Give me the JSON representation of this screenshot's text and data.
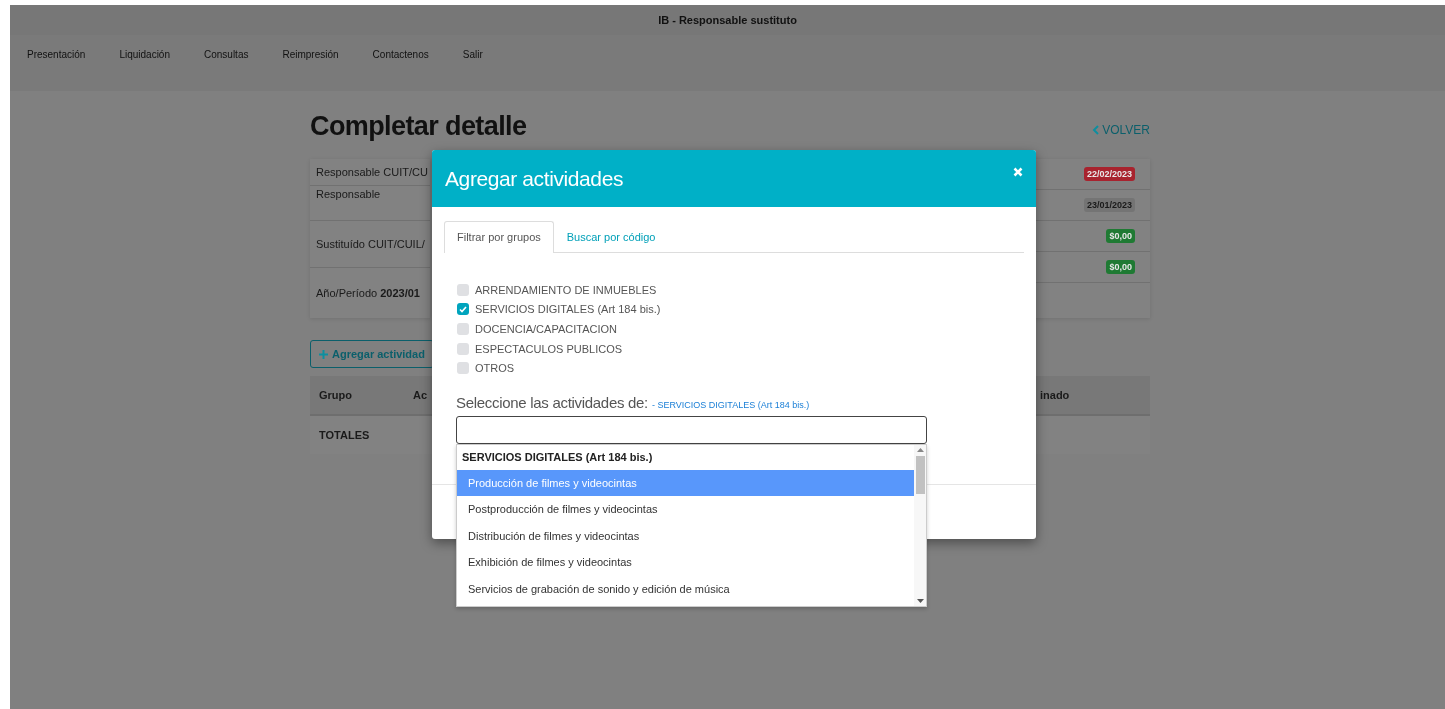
{
  "header": {
    "title": "IB - Responsable sustituto"
  },
  "menu": [
    {
      "label": "Presentación"
    },
    {
      "label": "Liquidación"
    },
    {
      "label": "Consultas"
    },
    {
      "label": "Reimpresión"
    },
    {
      "label": "Contactenos"
    },
    {
      "label": "Salir"
    }
  ],
  "page": {
    "title": "Completar detalle",
    "back_link": "VOLVER"
  },
  "summary_left": [
    {
      "label": "Responsable CUIT/CU"
    },
    {
      "label": "Responsable"
    },
    {
      "label": "Sustituído CUIT/CUIL/"
    },
    {
      "label": "Año/Período **2023/01**"
    }
  ],
  "summary_right": [
    {
      "badge": "22/02/2023",
      "color": "#a8232e"
    },
    {
      "badge": "23/01/2023",
      "color": "#747474"
    },
    {
      "badge": "$0,00",
      "color": "#1f7a33"
    },
    {
      "badge": "$0,00",
      "color": "#1f7a33"
    }
  ],
  "add_button": {
    "label": "Agregar actividad"
  },
  "table": {
    "columns": [
      "Grupo",
      "Ac",
      "inado"
    ],
    "totals_label": "TOTALES"
  },
  "modal": {
    "title": "Agregar actividades",
    "tabs": [
      {
        "label": "Filtrar por grupos",
        "selected": true
      },
      {
        "label": "Buscar por código",
        "selected": false
      }
    ],
    "groups": [
      {
        "label": "ARRENDAMIENTO DE INMUEBLES",
        "checked": false
      },
      {
        "label": "SERVICIOS DIGITALES (Art 184 bis.)",
        "checked": true
      },
      {
        "label": "DOCENCIA/CAPACITACION",
        "checked": false
      },
      {
        "label": "ESPECTACULOS PUBLICOS",
        "checked": false
      },
      {
        "label": "OTROS",
        "checked": false
      }
    ],
    "select_label": "Seleccione las actividades de:",
    "selected_group": "- SERVICIOS DIGITALES (Art 184 bis.)",
    "dropdown": {
      "group_header": "SERVICIOS DIGITALES (Art 184 bis.)",
      "options": [
        {
          "label": "Producción de filmes y videocintas",
          "selected": true
        },
        {
          "label": "Postproducción de filmes y videocintas",
          "selected": false
        },
        {
          "label": "Distribución de filmes y videocintas",
          "selected": false
        },
        {
          "label": "Exhibición de filmes y videocintas",
          "selected": false
        },
        {
          "label": "Servicios de grabación de sonido y edición de música",
          "selected": false
        }
      ]
    }
  }
}
